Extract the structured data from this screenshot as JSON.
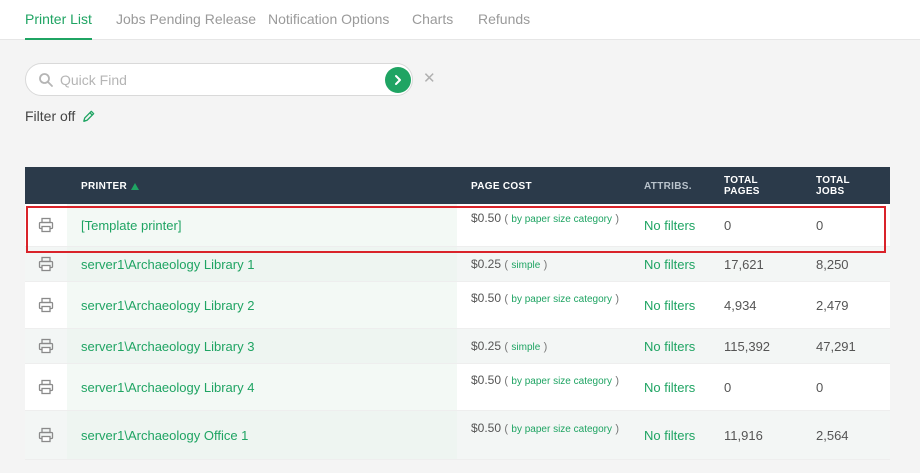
{
  "tabs": [
    {
      "label": "Printer List",
      "active": true
    },
    {
      "label": "Jobs Pending Release",
      "active": false
    },
    {
      "label": "Notification Options",
      "active": false
    },
    {
      "label": "Charts",
      "active": false
    },
    {
      "label": "Refunds",
      "active": false
    }
  ],
  "search": {
    "placeholder": "Quick Find",
    "value": "",
    "go_icon": "chevron-right-icon",
    "clear_icon": "close-icon"
  },
  "filter": {
    "label": "Filter off",
    "edit_icon": "pencil-icon"
  },
  "table": {
    "headers": {
      "printer": "PRINTER",
      "page_cost": "PAGE COST",
      "attribs": "ATTRIBS.",
      "total_pages": "TOTAL PAGES",
      "total_jobs": "TOTAL JOBS"
    },
    "sort": {
      "column": "printer",
      "direction": "ascending"
    },
    "rows": [
      {
        "name": "[Template printer]",
        "cost": "$0.50",
        "cost_mode": "by paper size category",
        "attribs": "No filters",
        "total_pages": "0",
        "total_jobs": "0",
        "highlighted": true
      },
      {
        "name": "server1\\Archaeology Library 1",
        "cost": "$0.25",
        "cost_mode": "simple",
        "attribs": "No filters",
        "total_pages": "17,621",
        "total_jobs": "8,250"
      },
      {
        "name": "server1\\Archaeology Library 2",
        "cost": "$0.50",
        "cost_mode": "by paper size category",
        "attribs": "No filters",
        "total_pages": "4,934",
        "total_jobs": "2,479"
      },
      {
        "name": "server1\\Archaeology Library 3",
        "cost": "$0.25",
        "cost_mode": "simple",
        "attribs": "No filters",
        "total_pages": "115,392",
        "total_jobs": "47,291"
      },
      {
        "name": "server1\\Archaeology Library 4",
        "cost": "$0.50",
        "cost_mode": "by paper size category",
        "attribs": "No filters",
        "total_pages": "0",
        "total_jobs": "0"
      },
      {
        "name": "server1\\Archaeology Office 1",
        "cost": "$0.50",
        "cost_mode": "by paper size category",
        "attribs": "No filters",
        "total_pages": "11,916",
        "total_jobs": "2,564"
      }
    ]
  },
  "colors": {
    "accent": "#1fa463",
    "header_bg": "#2b3a4a",
    "highlight": "#d9232a"
  }
}
